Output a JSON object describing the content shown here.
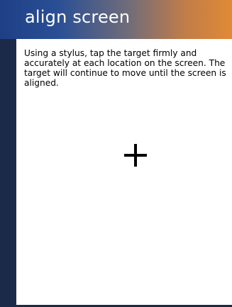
{
  "window": {
    "title": "align screen"
  },
  "content": {
    "instructions": "Using a stylus, tap the target firmly and accurately at each location on the screen. The target will continue to move until the screen is aligned."
  },
  "target": {
    "icon": "crosshair-target-icon"
  },
  "colors": {
    "title_gradient_start": "#1e3f86",
    "title_gradient_end": "#e08a36",
    "title_text": "#ffffff",
    "background": "#ffffff",
    "frame": "#1c2a4a"
  }
}
